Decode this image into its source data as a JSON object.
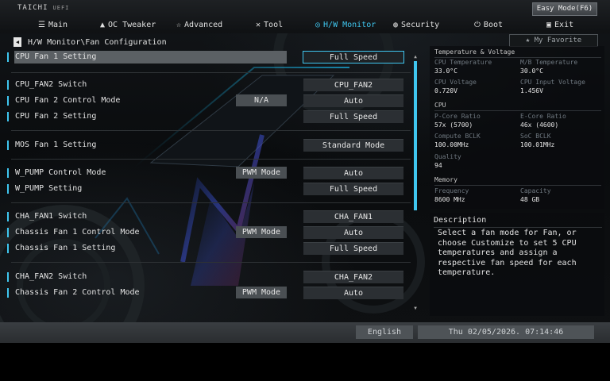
{
  "brand": {
    "name": "TAICHI",
    "sub": "UEFI"
  },
  "easy_mode_label": "Easy Mode(F6)",
  "nav": [
    {
      "label": "Main",
      "icon": "list-icon"
    },
    {
      "label": "OC Tweaker",
      "icon": "rocket-icon"
    },
    {
      "label": "Advanced",
      "icon": "star-icon"
    },
    {
      "label": "Tool",
      "icon": "tools-icon"
    },
    {
      "label": "H/W Monitor",
      "icon": "monitor-icon",
      "active": true
    },
    {
      "label": "Security",
      "icon": "shield-icon"
    },
    {
      "label": "Boot",
      "icon": "power-icon"
    },
    {
      "label": "Exit",
      "icon": "exit-icon"
    }
  ],
  "breadcrumb": "H/W Monitor\\Fan Configuration",
  "favorite_label": "My Favorite",
  "settings": [
    {
      "label": "CPU Fan 1 Setting",
      "value": "Full Speed",
      "selected": true
    },
    {
      "label": "CPU_FAN2 Switch",
      "value": "CPU_FAN2"
    },
    {
      "label": "CPU Fan 2 Control Mode",
      "mode": "N/A",
      "value": "Auto"
    },
    {
      "label": "CPU Fan 2 Setting",
      "value": "Full Speed"
    },
    {
      "label": "MOS Fan 1 Setting",
      "value": "Standard Mode"
    },
    {
      "label": "W_PUMP Control Mode",
      "mode": "PWM Mode",
      "value": "Auto"
    },
    {
      "label": "W_PUMP Setting",
      "value": "Full Speed"
    },
    {
      "label": "CHA_FAN1 Switch",
      "value": "CHA_FAN1"
    },
    {
      "label": "Chassis Fan 1 Control Mode",
      "mode": "PWM Mode",
      "value": "Auto"
    },
    {
      "label": "Chassis Fan 1 Setting",
      "value": "Full Speed"
    },
    {
      "label": "CHA_FAN2 Switch",
      "value": "CHA_FAN2"
    },
    {
      "label": "Chassis Fan 2 Control Mode",
      "mode": "PWM Mode",
      "value": "Auto"
    }
  ],
  "monitor": {
    "temp_voltage_title": "Temperature & Voltage",
    "cpu_temp_label": "CPU Temperature",
    "cpu_temp": "33.0°C",
    "mb_temp_label": "M/B Temperature",
    "mb_temp": "30.0°C",
    "cpu_voltage_label": "CPU Voltage",
    "cpu_voltage": "0.720V",
    "cpu_input_voltage_label": "CPU Input Voltage",
    "cpu_input_voltage": "1.456V",
    "cpu_title": "CPU",
    "pcore_label": "P-Core Ratio",
    "pcore": "57x (5700)",
    "ecore_label": "E-Core Ratio",
    "ecore": "46x (4600)",
    "compute_bclk_label": "Compute BCLK",
    "compute_bclk": "100.00MHz",
    "soc_bclk_label": "SoC BCLK",
    "soc_bclk": "100.01MHz",
    "quality_label": "Quality",
    "quality": "94",
    "memory_title": "Memory",
    "frequency_label": "Frequency",
    "frequency": "8600 MHz",
    "capacity_label": "Capacity",
    "capacity": "48 GB"
  },
  "description": {
    "title": "Description",
    "text": "Select a fan mode for Fan, or choose Customize to set 5 CPU temperatures and assign a respective fan speed for each temperature."
  },
  "footer": {
    "language": "English",
    "datetime": "Thu 02/05/2026. 07:14:46"
  },
  "colors": {
    "accent": "#3fc6ef",
    "selected_row": "#5b6064"
  }
}
